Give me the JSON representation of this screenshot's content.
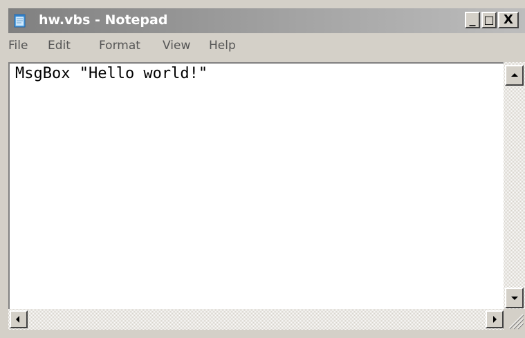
{
  "window": {
    "title": "hw.vbs - Notepad",
    "icon": "notepad-icon",
    "controls": {
      "minimize": "_",
      "maximize": "□",
      "close": "X"
    }
  },
  "menu": {
    "items": [
      "File",
      "Edit",
      "Format",
      "View",
      "Help"
    ]
  },
  "editor": {
    "content": "MsgBox \"Hello world!\""
  },
  "scrollbars": {
    "vertical": {
      "up_icon": "arrow-up-icon",
      "down_icon": "arrow-down-icon"
    },
    "horizontal": {
      "left_icon": "arrow-left-icon",
      "right_icon": "arrow-right-icon"
    }
  },
  "colors": {
    "titlebar_inactive_start": "#808080",
    "titlebar_inactive_end": "#bdbdbd",
    "face": "#d4d0c8"
  }
}
